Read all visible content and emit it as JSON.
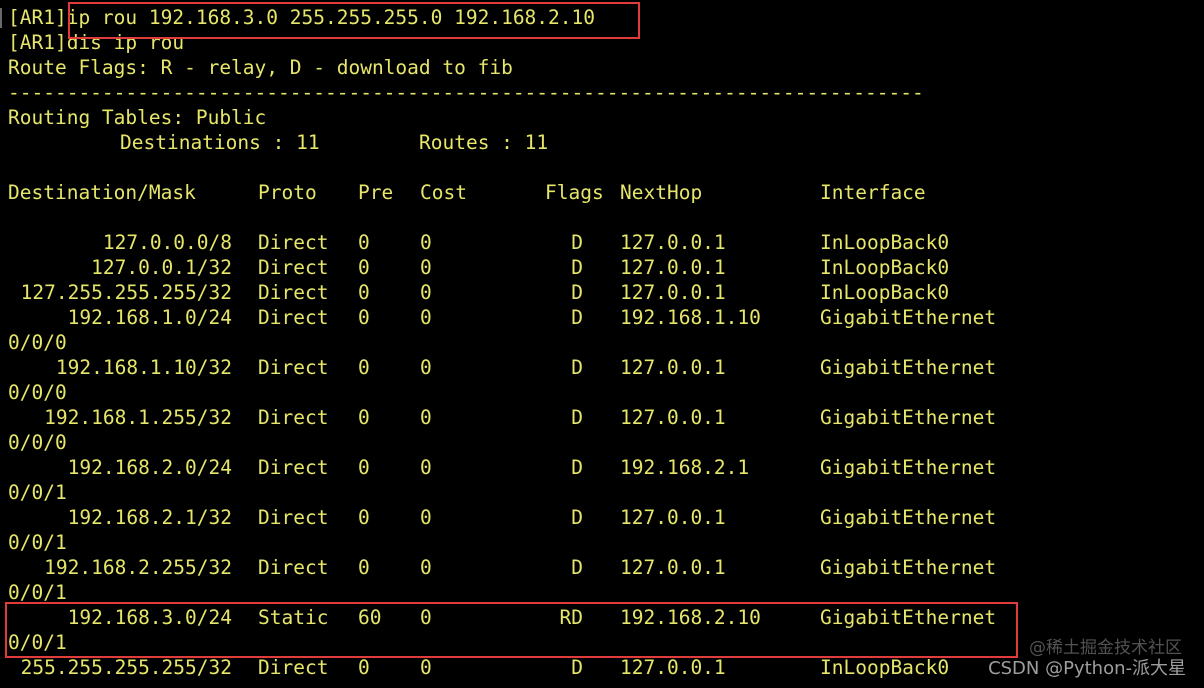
{
  "terminal": {
    "lines": {
      "cmd1": "[AR1]ip rou 192.168.3.0 255.255.255.0 192.168.2.10",
      "cmd2": "[AR1]dis ip rou",
      "flags_legend": "Route Flags: R - relay, D - download to fib",
      "separator": "------------------------------------------------------------------------------",
      "tables_title": "Routing Tables: Public",
      "destinations_label": "Destinations : 11",
      "routes_label": "Routes : 11"
    },
    "table": {
      "headers": {
        "dest": "Destination/Mask",
        "proto": "Proto",
        "pre": "Pre",
        "cost": "Cost",
        "flags": "Flags",
        "nexthop": "NextHop",
        "iface": "Interface"
      },
      "rows": [
        {
          "dest": "127.0.0.0/8",
          "proto": "Direct",
          "pre": "0",
          "cost": "0",
          "flags": "D",
          "nexthop": "127.0.0.1",
          "iface": "InLoopBack0",
          "cont": ""
        },
        {
          "dest": "127.0.0.1/32",
          "proto": "Direct",
          "pre": "0",
          "cost": "0",
          "flags": "D",
          "nexthop": "127.0.0.1",
          "iface": "InLoopBack0",
          "cont": ""
        },
        {
          "dest": "127.255.255.255/32",
          "proto": "Direct",
          "pre": "0",
          "cost": "0",
          "flags": "D",
          "nexthop": "127.0.0.1",
          "iface": "InLoopBack0",
          "cont": ""
        },
        {
          "dest": "192.168.1.0/24",
          "proto": "Direct",
          "pre": "0",
          "cost": "0",
          "flags": "D",
          "nexthop": "192.168.1.10",
          "iface": "GigabitEthernet",
          "cont": "0/0/0"
        },
        {
          "dest": "192.168.1.10/32",
          "proto": "Direct",
          "pre": "0",
          "cost": "0",
          "flags": "D",
          "nexthop": "127.0.0.1",
          "iface": "GigabitEthernet",
          "cont": "0/0/0"
        },
        {
          "dest": "192.168.1.255/32",
          "proto": "Direct",
          "pre": "0",
          "cost": "0",
          "flags": "D",
          "nexthop": "127.0.0.1",
          "iface": "GigabitEthernet",
          "cont": "0/0/0"
        },
        {
          "dest": "192.168.2.0/24",
          "proto": "Direct",
          "pre": "0",
          "cost": "0",
          "flags": "D",
          "nexthop": "192.168.2.1",
          "iface": "GigabitEthernet",
          "cont": "0/0/1"
        },
        {
          "dest": "192.168.2.1/32",
          "proto": "Direct",
          "pre": "0",
          "cost": "0",
          "flags": "D",
          "nexthop": "127.0.0.1",
          "iface": "GigabitEthernet",
          "cont": "0/0/1"
        },
        {
          "dest": "192.168.2.255/32",
          "proto": "Direct",
          "pre": "0",
          "cost": "0",
          "flags": "D",
          "nexthop": "127.0.0.1",
          "iface": "GigabitEthernet",
          "cont": "0/0/1"
        },
        {
          "dest": "192.168.3.0/24",
          "proto": "Static",
          "pre": "60",
          "cost": "0",
          "flags": "RD",
          "nexthop": "192.168.2.10",
          "iface": "GigabitEthernet",
          "cont": "0/0/1"
        },
        {
          "dest": "255.255.255.255/32",
          "proto": "Direct",
          "pre": "0",
          "cost": "0",
          "flags": "D",
          "nexthop": "127.0.0.1",
          "iface": "InLoopBack0",
          "cont": ""
        }
      ]
    }
  },
  "watermark": {
    "top": "@稀土掘金技术社区",
    "bottom": "CSDN @Python-派大星"
  },
  "colors": {
    "background": "#000000",
    "text": "#e6e66a",
    "highlight_border": "#e23b3b"
  }
}
